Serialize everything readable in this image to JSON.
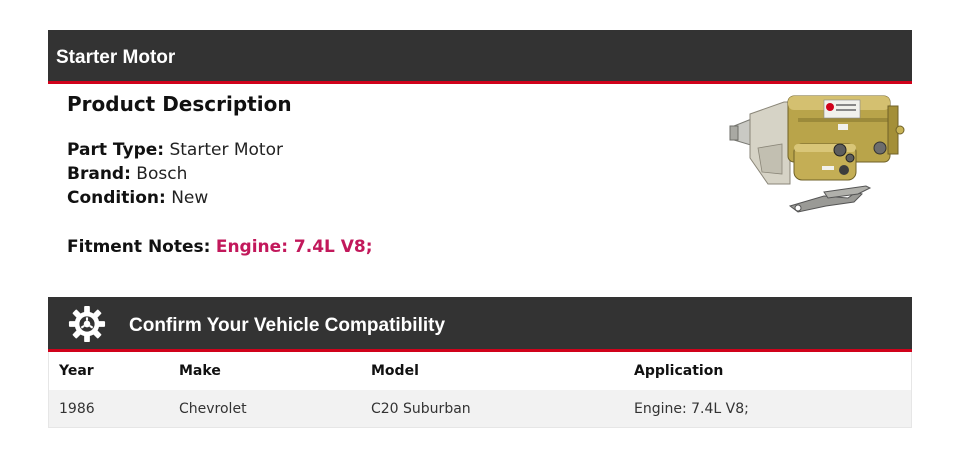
{
  "header": {
    "title": "Starter Motor"
  },
  "product": {
    "heading": "Product Description",
    "part_type_label": "Part Type:",
    "part_type_value": "Starter Motor",
    "brand_label": "Brand:",
    "brand_value": "Bosch",
    "condition_label": "Condition:",
    "condition_value": "New",
    "fitment_label": "Fitment Notes:",
    "fitment_value": "Engine: 7.4L V8;"
  },
  "compatibility": {
    "title": "Confirm Your Vehicle Compatibility",
    "columns": [
      "Year",
      "Make",
      "Model",
      "Application"
    ],
    "rows": [
      {
        "year": "1986",
        "make": "Chevrolet",
        "model": "C20 Suburban",
        "application": "Engine: 7.4L V8;"
      }
    ]
  },
  "colors": {
    "bar": "#333333",
    "accent": "#d0021b",
    "fitment": "#c2185b",
    "row_alt": "#f2f2f2"
  }
}
